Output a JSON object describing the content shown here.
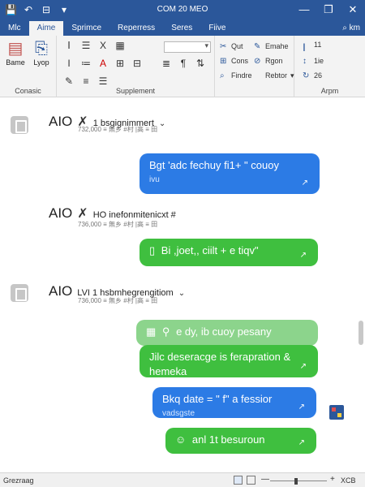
{
  "window": {
    "title": "COM 20 MEO",
    "minimize": "—",
    "restore": "❐",
    "close": "✕"
  },
  "quick_access": {
    "save_icon": "💾",
    "undo_icon": "↶",
    "layout_icon": "⊟",
    "more_icon": "▾"
  },
  "tabs": [
    {
      "label": "Mlc"
    },
    {
      "label": "Aime"
    },
    {
      "label": "Sprimce"
    },
    {
      "label": "Reperress"
    },
    {
      "label": "Seres"
    },
    {
      "label": "Fiive"
    }
  ],
  "search": {
    "label": "⌕ km"
  },
  "ribbon": {
    "clipboard": {
      "label": "Conasic",
      "btn1": "Bame",
      "btn2": "Lyop"
    },
    "paragraph": {
      "label": "Supplement"
    },
    "styles": {
      "items": [
        {
          "icon": "✂",
          "label": "Qut"
        },
        {
          "icon": "✎",
          "label": "Emahe"
        },
        {
          "icon": "⊞",
          "label": "Cons"
        },
        {
          "icon": "⊘",
          "label": "Rgon"
        },
        {
          "icon": "⌕",
          "label": "Findre"
        },
        {
          "icon": "",
          "label": "Rebtor"
        }
      ]
    },
    "arrange": {
      "label": "Arpm",
      "r1": "11",
      "r2": "1ie",
      "r3": "26"
    }
  },
  "messages": [
    {
      "name": "AIO",
      "subject": "1 bsgignimmert",
      "meta": "732,000 ≡ 無乡 #村 |高 ≡ 田",
      "bubble": {
        "text": "Bgt 'adc fechuy fi1+ \" couoy",
        "sub": "ivu",
        "tick": "↗"
      }
    },
    {
      "name": "AIO",
      "subject": "HO inefonmitenicxt #",
      "meta": "736,000 ≡ 無乡 #村 |高 ≡ 田",
      "bubble": {
        "text": "Bi ,joet,, ciilt + e tiqv\"",
        "tick": "↗"
      }
    },
    {
      "name": "AIO",
      "subject": "LVI 1 hsbmhegrengitiom",
      "meta": "736,000 ≡ 無乡 #村 |高 ≡ 田",
      "bubbles": [
        {
          "text": "e dy, ib cuoy pesany"
        },
        {
          "text": "Jilc deseracge is ferapration &",
          "sub": "hemeka",
          "tick": "↗"
        },
        {
          "text": "Bkq date = \" f\" a fessior",
          "sub": "vadsgste",
          "tick": "↗"
        },
        {
          "text": "anl 1t besuroun",
          "tick": "↗"
        }
      ]
    }
  ],
  "status": {
    "left": "Grezraag",
    "zoom": "XCB",
    "zoom_level": 0.45
  },
  "colors": {
    "accent": "#2b579a",
    "bubble_blue": "#2c7be5",
    "bubble_green": "#3fbf3f"
  }
}
